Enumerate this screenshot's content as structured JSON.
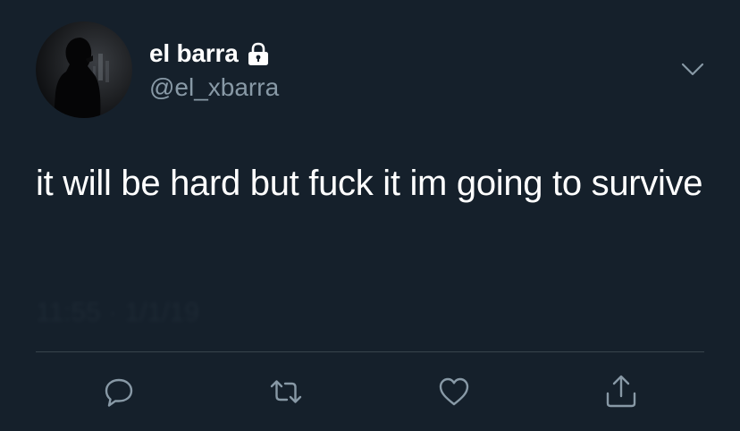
{
  "user": {
    "display_name": "el barra",
    "handle": "@el_xbarra",
    "protected": true
  },
  "tweet": {
    "text": "it will be hard but fuck it im going to survive",
    "timestamp": "11:55 · 1/1/19"
  },
  "colors": {
    "background": "#15202b",
    "text_primary": "#ffffff",
    "text_secondary": "#8899a6",
    "divider": "#38444d"
  },
  "icons": {
    "lock": "lock-icon",
    "menu": "chevron-down-icon",
    "reply": "reply-icon",
    "retweet": "retweet-icon",
    "like": "heart-icon",
    "share": "share-icon"
  }
}
